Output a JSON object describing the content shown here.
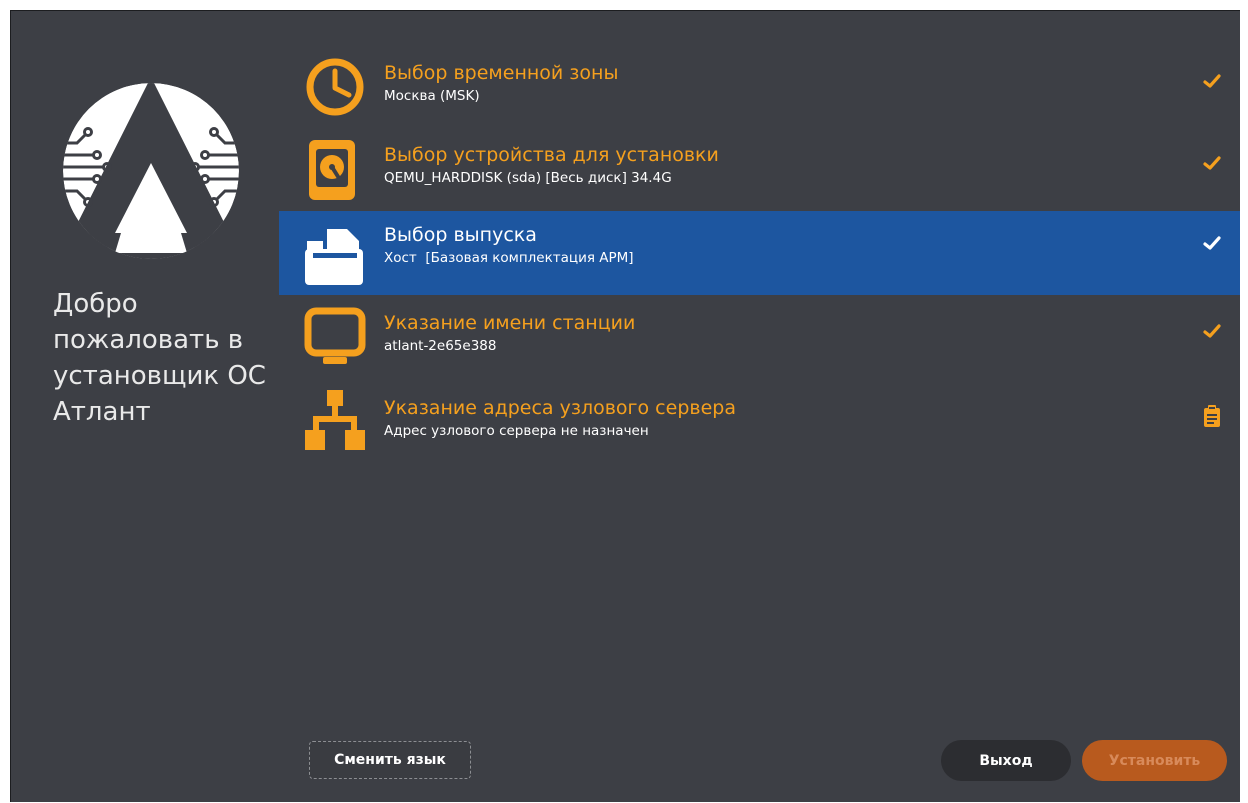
{
  "sidebar": {
    "welcome_text": "Добро пожаловать в установщик ОС Атлант"
  },
  "spokes": [
    {
      "title": "Выбор временной зоны",
      "status": "Москва (MSK)",
      "icon": "clock-icon",
      "state": "done"
    },
    {
      "title": "Выбор устройства для установки",
      "status": "QEMU_HARDDISK (sda) [Весь диск] 34.4G",
      "icon": "hard-disk-icon",
      "state": "done"
    },
    {
      "title": "Выбор выпуска",
      "status": "Хост  [Базовая комплектация АРМ]",
      "icon": "package-icon",
      "state": "done",
      "selected": true
    },
    {
      "title": "Указание имени станции",
      "status": "atlant-2e65e388",
      "icon": "monitor-icon",
      "state": "done"
    },
    {
      "title": "Указание адреса узлового сервера",
      "status": "Адрес узлового сервера не назначен",
      "icon": "network-tree-icon",
      "state": "warning"
    }
  ],
  "buttons": {
    "change_language": "Сменить язык",
    "exit": "Выход",
    "install": "Установить"
  },
  "colors": {
    "background": "#3d3f45",
    "accent": "#f5a01e",
    "selected": "#1d56a0",
    "install_button": "#b85a1e"
  }
}
